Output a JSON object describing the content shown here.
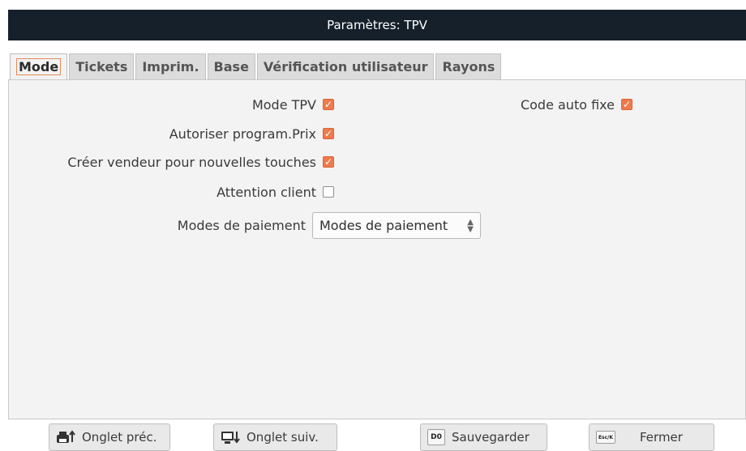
{
  "window": {
    "title": "Paramètres: TPV"
  },
  "tabs": [
    {
      "label": "Mode"
    },
    {
      "label": "Tickets"
    },
    {
      "label": "Imprim."
    },
    {
      "label": "Base"
    },
    {
      "label": "Vérification utilisateur"
    },
    {
      "label": "Rayons"
    }
  ],
  "active_tab": "Mode",
  "options": {
    "mode_tpv": {
      "label": "Mode TPV",
      "checked": true
    },
    "code_auto_fixe": {
      "label": "Code auto fixe",
      "checked": true
    },
    "autoriser_prix": {
      "label": "Autoriser program.Prix",
      "checked": true
    },
    "creer_vendeur": {
      "label": "Créer vendeur pour nouvelles touches",
      "checked": true
    },
    "attention_client": {
      "label": "Attention client",
      "checked": false
    }
  },
  "payment": {
    "label": "Modes de paiement",
    "selected": "Modes de paiement"
  },
  "buttons": {
    "prev": {
      "label": "Onglet préc.",
      "icon": "printer-up-icon"
    },
    "next": {
      "label": "Onglet suiv.",
      "icon": "monitor-down-icon"
    },
    "save": {
      "label": "Sauvegarder",
      "key": "D0",
      "icon": "save-key-icon"
    },
    "close": {
      "label": "Fermer",
      "key": "Esc/K",
      "icon": "esc-key-icon"
    }
  },
  "colors": {
    "titlebar": "#15202b",
    "checkbox": "#ef7a4c",
    "accent": "#e58a5c"
  }
}
